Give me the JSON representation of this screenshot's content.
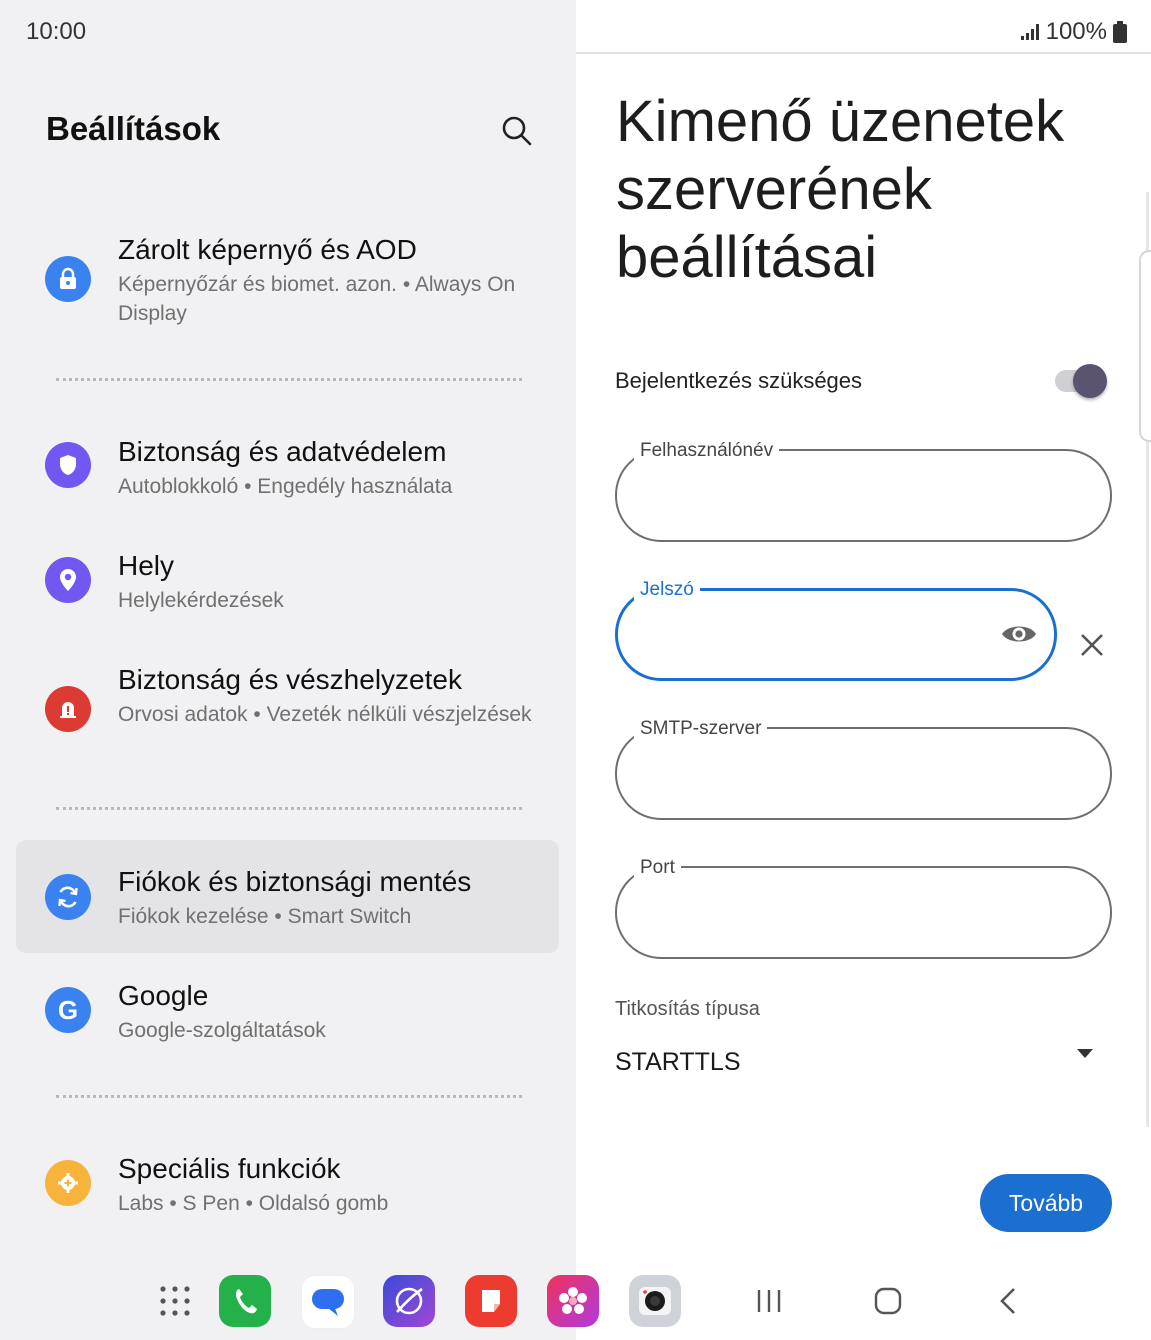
{
  "status_bar": {
    "time": "10:00",
    "battery": "100%",
    "signal_icon": "signal-icon",
    "battery_icon": "battery-icon"
  },
  "settings": {
    "title": "Beállítások",
    "items": [
      {
        "title": "Zárolt képernyő és AOD",
        "subtitle": "Képernyőzár és biomet. azon.  •  Always On Display",
        "icon": "lock-icon",
        "color": "#3a82f0"
      },
      {
        "title": "Biztonság és adatvédelem",
        "subtitle": "Autoblokkoló  •  Engedély használata",
        "icon": "shield-icon",
        "color": "#7257f0"
      },
      {
        "title": "Hely",
        "subtitle": "Helylekérdezések",
        "icon": "location-icon",
        "color": "#7257f0"
      },
      {
        "title": "Biztonság és vészhelyzetek",
        "subtitle": "Orvosi adatok  •  Vezeték nélküli vészjelzések",
        "icon": "emergency-icon",
        "color": "#dc3b34"
      },
      {
        "title": "Fiókok és biztonsági mentés",
        "subtitle": "Fiókok kezelése  •  Smart Switch",
        "icon": "sync-icon",
        "color": "#3a82f0"
      },
      {
        "title": "Google",
        "subtitle": "Google-szolgáltatások",
        "icon": "google-icon",
        "color": "#3a82f0"
      },
      {
        "title": "Speciális funkciók",
        "subtitle": "Labs  •  S Pen  •  Oldalsó gomb",
        "icon": "gear-plus-icon",
        "color": "#f7b33b"
      }
    ]
  },
  "form": {
    "heading": "Kimenő üzenetek szerverének beállításai",
    "login_required_label": "Bejelentkezés szükséges",
    "login_required": true,
    "username_label": "Felhasználónév",
    "username_value": "",
    "password_label": "Jelszó",
    "password_value": "",
    "smtp_label": "SMTP-szerver",
    "smtp_value": "",
    "port_label": "Port",
    "port_value": "",
    "encryption_label": "Titkosítás típusa",
    "encryption_value": "STARTTLS",
    "next_button": "Tovább"
  },
  "dock": {
    "apps": [
      "apps-grid-icon",
      "phone-icon",
      "messages-icon",
      "internet-icon",
      "notes-icon",
      "gallery-icon",
      "camera-icon"
    ],
    "nav": [
      "recents-icon",
      "home-icon",
      "back-icon"
    ]
  }
}
